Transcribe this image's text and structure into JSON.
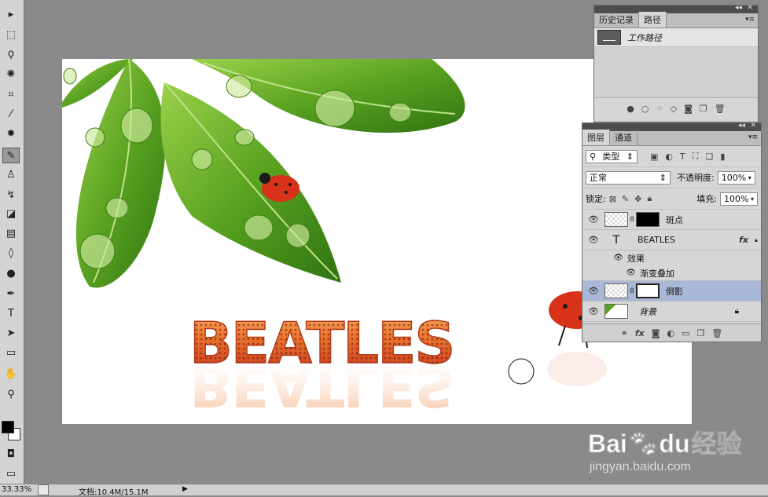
{
  "tools": [
    {
      "icon": "move-tool-icon",
      "glyph": "▸"
    },
    {
      "icon": "marquee-tool-icon",
      "glyph": "⬚"
    },
    {
      "icon": "lasso-tool-icon",
      "glyph": "ϙ"
    },
    {
      "icon": "quick-select-tool-icon",
      "glyph": "✺"
    },
    {
      "icon": "crop-tool-icon",
      "glyph": "⌗"
    },
    {
      "icon": "eyedropper-tool-icon",
      "glyph": "⁄"
    },
    {
      "icon": "healing-brush-tool-icon",
      "glyph": "✹"
    },
    {
      "icon": "brush-tool-icon",
      "glyph": "✎"
    },
    {
      "icon": "clone-stamp-tool-icon",
      "glyph": "♙"
    },
    {
      "icon": "history-brush-tool-icon",
      "glyph": "↯"
    },
    {
      "icon": "eraser-tool-icon",
      "glyph": "◪"
    },
    {
      "icon": "gradient-tool-icon",
      "glyph": "▤"
    },
    {
      "icon": "blur-tool-icon",
      "glyph": "◊"
    },
    {
      "icon": "dodge-tool-icon",
      "glyph": "●"
    },
    {
      "icon": "pen-tool-icon",
      "glyph": "✒"
    },
    {
      "icon": "type-tool-icon",
      "glyph": "T"
    },
    {
      "icon": "path-select-tool-icon",
      "glyph": "➤"
    },
    {
      "icon": "shape-tool-icon",
      "glyph": "▭"
    },
    {
      "icon": "hand-tool-icon",
      "glyph": "✋"
    },
    {
      "icon": "zoom-tool-icon",
      "glyph": "⚲"
    }
  ],
  "paths_panel": {
    "tabs": [
      "历史记录",
      "路径"
    ],
    "work_path_label": "工作路径"
  },
  "layers_panel": {
    "tabs": [
      "图层",
      "通道"
    ],
    "filter_label": "类型",
    "blend_mode": "正常",
    "opacity_label": "不透明度:",
    "opacity_value": "100%",
    "lock_label": "锁定:",
    "fill_label": "填充:",
    "fill_value": "100%",
    "layers": [
      {
        "name": "斑点",
        "type": "masked"
      },
      {
        "name": "BEATLES",
        "type": "text",
        "fx": "fx"
      },
      {
        "name": "效果",
        "type": "effect-group"
      },
      {
        "name": "渐变叠加",
        "type": "effect"
      },
      {
        "name": "倒影",
        "type": "masked",
        "selected": true
      },
      {
        "name": "背景",
        "type": "background"
      }
    ]
  },
  "canvas_text": "BEATLES",
  "status": {
    "zoom": "33.33%",
    "doc_label": "文档:10.4M/15.1M"
  },
  "watermark": {
    "brand": "Bai",
    "brand2": "du",
    "cn": "经验",
    "url": "jingyan.baidu.com"
  },
  "colors": {
    "workspace": "#8a8a8a",
    "panel": "#d6d6d6",
    "selected_layer": "#aab8d8",
    "text_orange": "#e46a2a"
  }
}
